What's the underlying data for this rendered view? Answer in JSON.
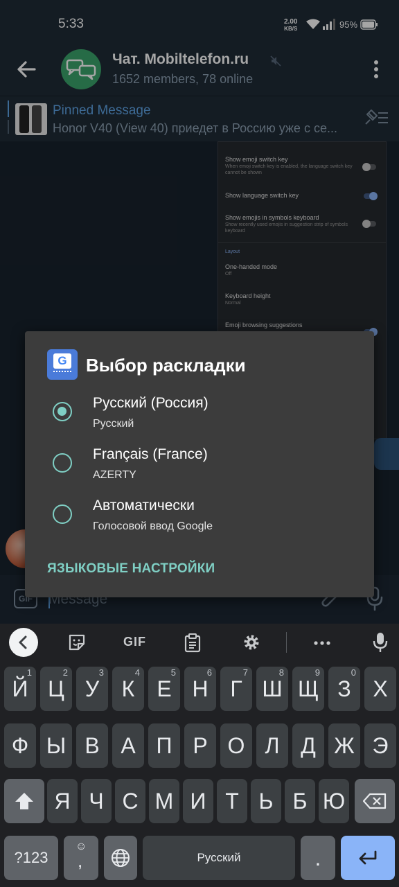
{
  "status_bar": {
    "time": "5:33",
    "speed_value": "2.00",
    "speed_unit": "KB/S",
    "battery": "95%"
  },
  "header": {
    "title": "Чат. Mobiltelefon.ru",
    "subtitle": "1652 members, 78 online"
  },
  "pinned": {
    "title": "Pinned Message",
    "text": "Honor V40 (View 40) приедет в Россию уже с се..."
  },
  "screenshot_settings": {
    "items": [
      {
        "title": "Show emoji switch key",
        "desc": "When emoji switch key is enabled, the language switch key cannot be shown"
      },
      {
        "title": "Show language switch key",
        "desc": ""
      },
      {
        "title": "Show emojis in symbols keyboard",
        "desc": "Show recently used emojis in suggestion strip of symbols keyboard"
      }
    ],
    "section": "Layout",
    "layout_items": [
      {
        "title": "One-handed mode",
        "desc": "Off"
      },
      {
        "title": "Keyboard height",
        "desc": "Normal"
      },
      {
        "title": "Emoji browsing suggestions",
        "desc": ""
      }
    ]
  },
  "composer": {
    "placeholder": "Message",
    "gif_label": "GIF"
  },
  "dialog": {
    "title": "Выбор раскладки",
    "options": [
      {
        "label": "Русский (Россия)",
        "sub": "Русский",
        "selected": true
      },
      {
        "label": "Français (France)",
        "sub": "AZERTY",
        "selected": false
      },
      {
        "label": "Автоматически",
        "sub": "Голосовой ввод Google",
        "selected": false
      }
    ],
    "link": "ЯЗЫКОВЫЕ НАСТРОЙКИ"
  },
  "keyboard": {
    "toolbar_gif": "GIF",
    "row1": [
      {
        "k": "Й",
        "h": "1"
      },
      {
        "k": "Ц",
        "h": "2"
      },
      {
        "k": "У",
        "h": "3"
      },
      {
        "k": "К",
        "h": "4"
      },
      {
        "k": "Е",
        "h": "5"
      },
      {
        "k": "Н",
        "h": "6"
      },
      {
        "k": "Г",
        "h": "7"
      },
      {
        "k": "Ш",
        "h": "8"
      },
      {
        "k": "Щ",
        "h": "9"
      },
      {
        "k": "З",
        "h": "0"
      },
      {
        "k": "Х",
        "h": ""
      }
    ],
    "row2": [
      "Ф",
      "Ы",
      "В",
      "А",
      "П",
      "Р",
      "О",
      "Л",
      "Д",
      "Ж",
      "Э"
    ],
    "row3": [
      "Я",
      "Ч",
      "С",
      "М",
      "И",
      "Т",
      "Ь",
      "Б",
      "Ю"
    ],
    "symbols_key": "?123",
    "comma_key": ",",
    "space_label": "Русский",
    "period_key": "."
  }
}
